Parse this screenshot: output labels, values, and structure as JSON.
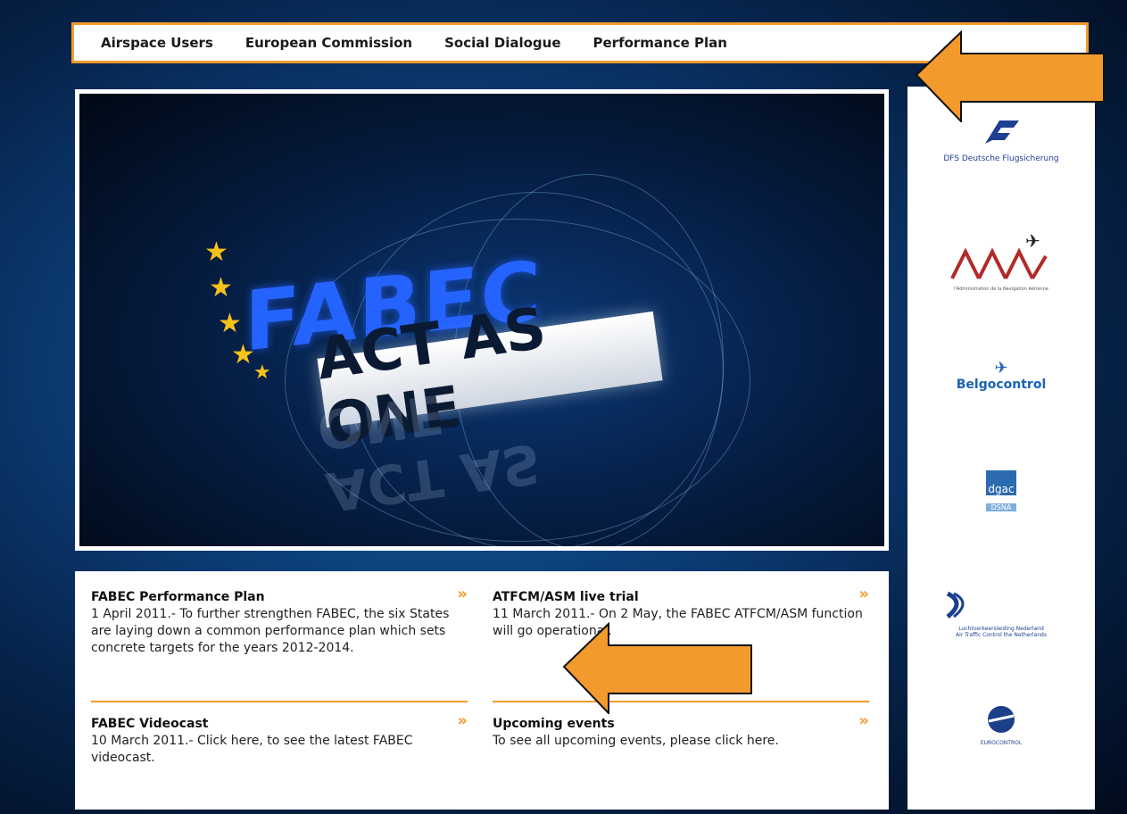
{
  "nav": {
    "items": [
      "Airspace Users",
      "European Commission",
      "Social Dialogue",
      "Performance Plan"
    ]
  },
  "hero": {
    "title": "FABEC",
    "slogan": "ACT AS ONE"
  },
  "news": [
    {
      "title": "FABEC Performance Plan",
      "text": "1 April 2011.- To further strengthen FABEC, the six States are laying down a common performance plan which sets concrete targets for the years 2012-2014.",
      "more": "»"
    },
    {
      "title": "ATFCM/ASM live trial",
      "text": "11 March 2011.- On 2 May, the FABEC ATFCM/ASM function will go operational.",
      "more": "»"
    },
    {
      "title": "FABEC Videocast",
      "text": "10 March 2011.- Click here, to see the latest FABEC videocast.",
      "more": "»"
    },
    {
      "title": "Upcoming events",
      "text": "To see all upcoming events, please click here.",
      "more": "»"
    }
  ],
  "partners": [
    {
      "name": "DFS Deutsche Flugsicherung",
      "icon": "dfs-logo-icon"
    },
    {
      "name": "l'Administration de la Navigation Aérienne",
      "icon": "ana-logo-icon"
    },
    {
      "name": "Belgocontrol",
      "icon": "belgocontrol-logo-icon"
    },
    {
      "name": "dgac",
      "sub": "DSNA",
      "icon": "dgac-logo-icon"
    },
    {
      "name": "Luchtverkeersleiding Nederland",
      "sub": "Air Traffic Control the Netherlands",
      "icon": "lvnl-logo-icon"
    },
    {
      "name": "EUROCONTROL",
      "icon": "eurocontrol-logo-icon"
    }
  ],
  "colors": {
    "accent": "#f39a2c",
    "background_deep": "#0c3f7a"
  }
}
